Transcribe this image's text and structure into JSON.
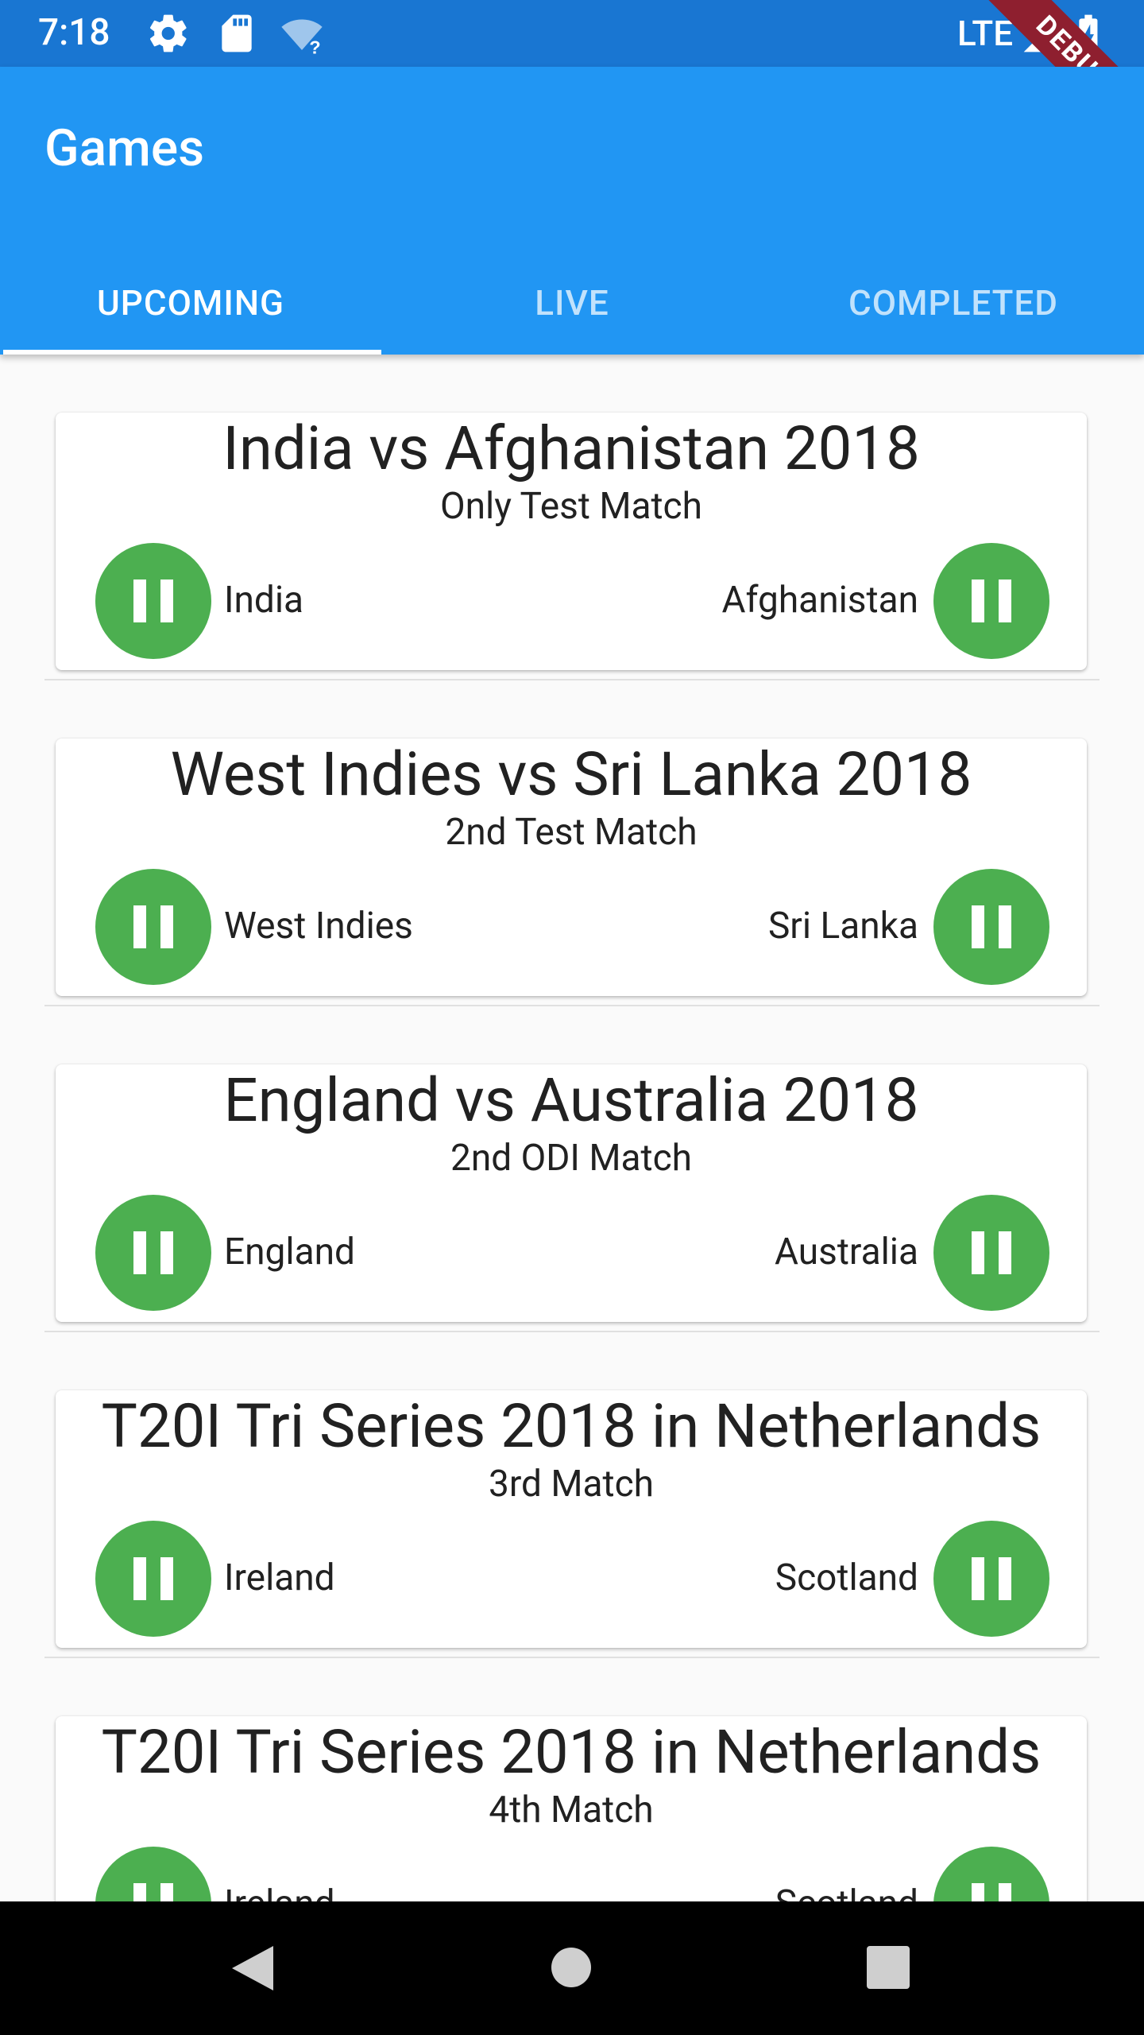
{
  "status_bar": {
    "time": "7:18",
    "network": "LTE",
    "icons": [
      "settings-icon",
      "sd-card-icon",
      "wifi-unknown-icon",
      "signal-icon",
      "battery-charging-icon"
    ],
    "debug_banner": "DEBUG"
  },
  "app_bar": {
    "title": "Games",
    "background": "#2196f3"
  },
  "tabs": [
    {
      "label": "UPCOMING",
      "selected": true
    },
    {
      "label": "LIVE",
      "selected": false
    },
    {
      "label": "COMPLETED",
      "selected": false
    }
  ],
  "matches": [
    {
      "title": "India vs Afghanistan 2018",
      "subtitle": "Only Test Match",
      "team1": "India",
      "team2": "Afghanistan"
    },
    {
      "title": "West Indies vs Sri Lanka 2018",
      "subtitle": "2nd Test Match",
      "team1": "West Indies",
      "team2": "Sri Lanka"
    },
    {
      "title": "England vs Australia 2018",
      "subtitle": "2nd ODI Match",
      "team1": "England",
      "team2": "Australia"
    },
    {
      "title": "T20I Tri Series 2018 in Netherlands",
      "subtitle": "3rd Match",
      "team1": "Ireland",
      "team2": "Scotland"
    },
    {
      "title": "T20I Tri Series 2018 in Netherlands",
      "subtitle": "4th Match",
      "team1": "Ireland",
      "team2": "Scotland"
    }
  ],
  "colors": {
    "status_bar": "#1976d2",
    "accent": "#2196f3",
    "avatar": "#4caf50"
  },
  "nav_bar": {
    "icons": [
      "back-icon",
      "home-icon",
      "recents-icon"
    ]
  }
}
